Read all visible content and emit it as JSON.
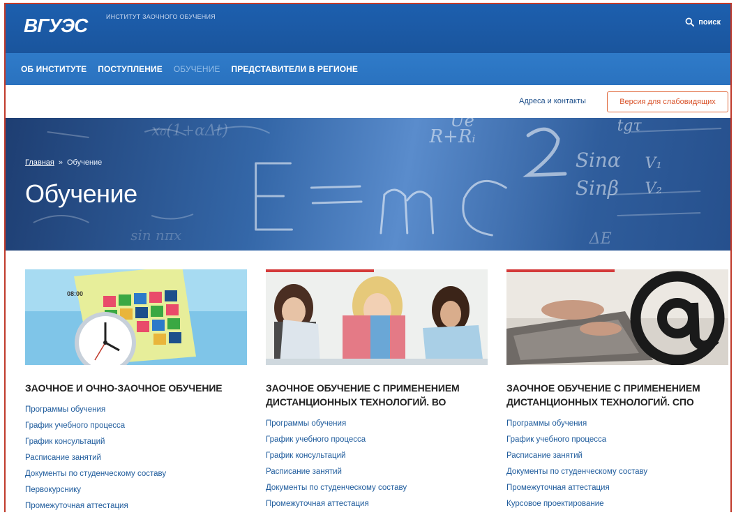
{
  "header": {
    "logo_text": "ВГУЭС",
    "institute_name": "ИНСТИТУТ ЗАОЧНОГО ОБУЧЕНИЯ",
    "search_label": "поиск"
  },
  "nav": {
    "items": [
      {
        "label": "ОБ ИНСТИТУТЕ",
        "active": false
      },
      {
        "label": "ПОСТУПЛЕНИЕ",
        "active": false
      },
      {
        "label": "ОБУЧЕНИЕ",
        "active": true
      },
      {
        "label": "ПРЕДСТАВИТЕЛИ В РЕГИОНЕ",
        "active": false
      }
    ]
  },
  "utility": {
    "contacts_link": "Адреса и контакты",
    "low_vision_button": "Версия для слабовидящих"
  },
  "hero": {
    "breadcrumb_home": "Главная",
    "breadcrumb_sep": "»",
    "breadcrumb_current": "Обучение",
    "title": "Обучение"
  },
  "cards": [
    {
      "title": "ЗАОЧНОЕ И ОЧНО-ЗАОЧНОЕ ОБУЧЕНИЕ",
      "links": [
        "Программы обучения",
        "График учебного процесса",
        "График консультаций",
        "Расписание занятий",
        "Документы по студенческому составу",
        "Первокурснику",
        "Промежуточная аттестация"
      ]
    },
    {
      "title": "ЗАОЧНОЕ ОБУЧЕНИЕ С ПРИМЕНЕНИЕМ ДИСТАНЦИОННЫХ ТЕХНОЛОГИЙ. ВО",
      "links": [
        "Программы обучения",
        "График учебного процесса",
        "График консультаций",
        "Расписание занятий",
        "Документы по студенческому составу",
        "Промежуточная аттестация"
      ]
    },
    {
      "title": "ЗАОЧНОЕ ОБУЧЕНИЕ С ПРИМЕНЕНИЕМ ДИСТАНЦИОННЫХ ТЕХНОЛОГИЙ. СПО",
      "links": [
        "Программы обучения",
        "График учебного процесса",
        "Расписание занятий",
        "Документы по студенческому составу",
        "Промежуточная аттестация",
        "Курсовое проектирование"
      ]
    }
  ],
  "colors": {
    "header_blue": "#1d5fae",
    "nav_blue": "#2f7bc9",
    "link_blue": "#1e5b9c",
    "accent_red": "#d43a3a",
    "button_orange": "#d9542b"
  },
  "icons": {
    "search": "search-icon",
    "logo": "vgues-logo"
  }
}
